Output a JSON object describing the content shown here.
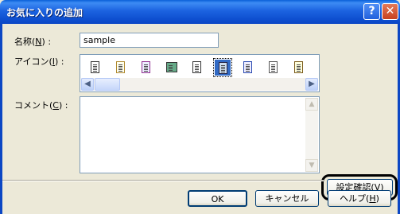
{
  "window": {
    "title": "お気に入りの追加"
  },
  "titlebar_buttons": {
    "help": "?",
    "close": "✕"
  },
  "name_field": {
    "label": "名称(",
    "accesskey": "N",
    "label_end": ") :",
    "value": "sample"
  },
  "icon_field": {
    "label": "アイコン(",
    "accesskey": "I",
    "label_end": ") :",
    "icons": [
      "document-icon",
      "document-icon",
      "document-icon",
      "image-document-icon",
      "document-icon",
      "document-icon",
      "edit-document-icon",
      "text-document-icon",
      "document-icon"
    ],
    "selected_index": 5,
    "scroll_left": "◀",
    "scroll_right": "▶"
  },
  "comment_field": {
    "label": "コメント(",
    "accesskey": "C",
    "label_end": ") :",
    "value": ""
  },
  "buttons": {
    "confirm_settings": "設定確認(",
    "confirm_settings_key": "V",
    "confirm_settings_end": ")",
    "ok": "OK",
    "cancel": "キャンセル",
    "help": "ヘルプ(",
    "help_key": "H",
    "help_end": ")"
  }
}
